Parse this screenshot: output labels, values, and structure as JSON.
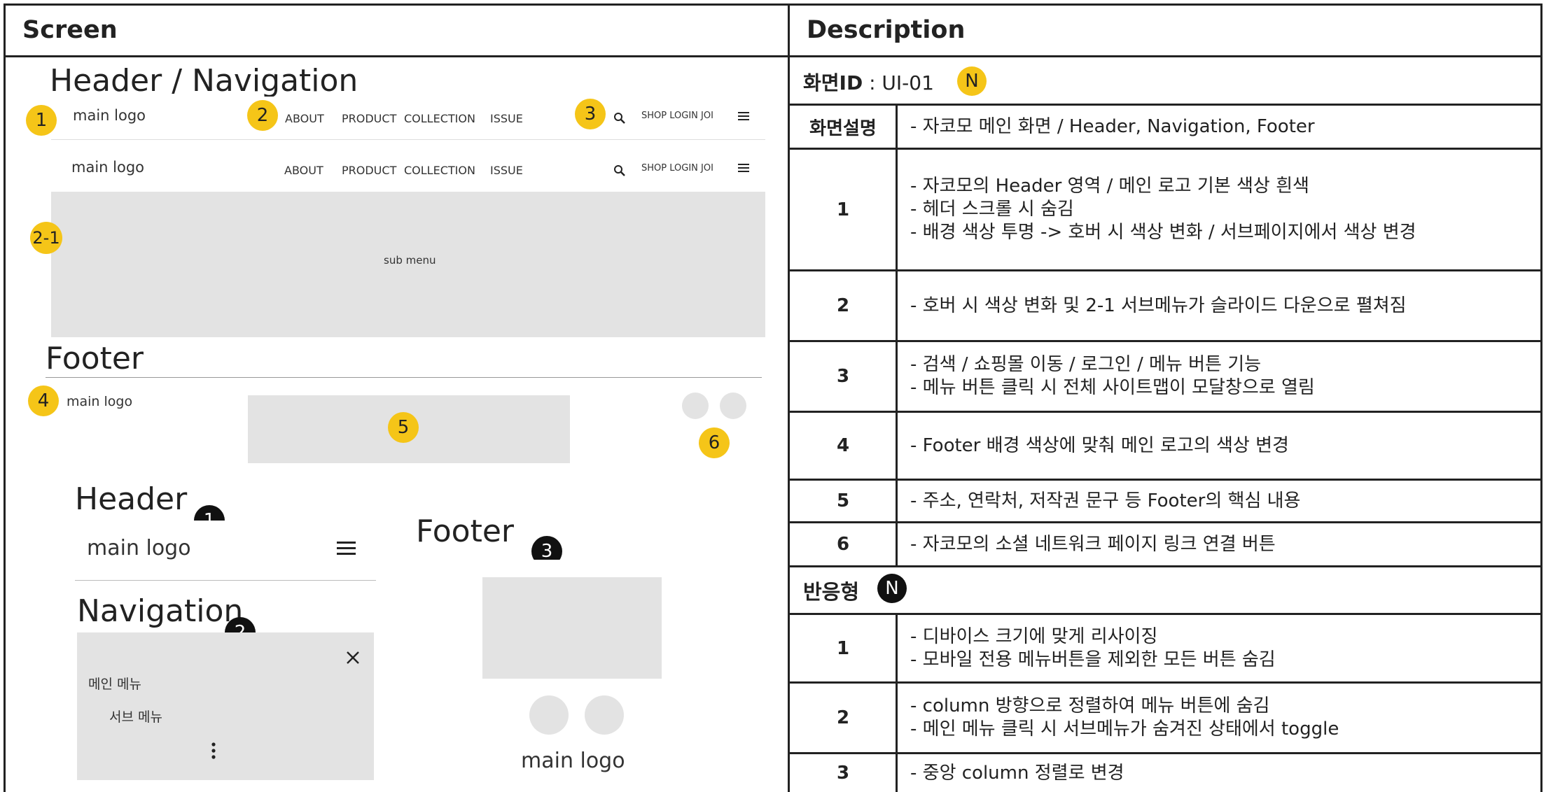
{
  "table_header": {
    "screen": "Screen",
    "description": "Description"
  },
  "left": {
    "section1_title": "Header / Navigation",
    "logo": "main logo",
    "nav": [
      "ABOUT",
      "PRODUCT",
      "COLLECTION",
      "ISSUE"
    ],
    "util_text": "SHOP LOGIN JOI",
    "submenu": "sub menu",
    "badges": {
      "b1": "1",
      "b2": "2",
      "b3": "3",
      "b21": "2-1",
      "b4": "4",
      "b5": "5",
      "b6": "6"
    },
    "footer_title": "Footer",
    "mobile": {
      "header_title": "Header",
      "nav_title": "Navigation",
      "footer_title": "Footer",
      "main_menu": "메인 메뉴",
      "sub_menu": "서브 메뉴",
      "badges": {
        "m1": "1",
        "m2": "2",
        "m3": "3"
      }
    }
  },
  "right": {
    "screen_id_label": "화면ID",
    "screen_id_value": " : UI-01",
    "screen_id_badge": "N",
    "rows": [
      {
        "num": "화면설명",
        "lines": [
          "-  자코모 메인 화면 / Header, Navigation, Footer"
        ]
      },
      {
        "num": "1",
        "lines": [
          "-  자코모의 Header 영역 / 메인 로고 기본 색상 흰색",
          "-  헤더 스크롤 시 숨김",
          "-  배경 색상 투명 -> 호버 시 색상 변화 / 서브페이지에서 색상 변경"
        ]
      },
      {
        "num": "2",
        "lines": [
          "-  호버 시 색상 변화 및 2-1 서브메뉴가 슬라이드 다운으로 펼쳐짐"
        ]
      },
      {
        "num": "3",
        "lines": [
          "-  검색 / 쇼핑몰 이동 / 로그인 / 메뉴 버튼 기능",
          "-  메뉴 버튼 클릭 시 전체 사이트맵이 모달창으로 열림"
        ]
      },
      {
        "num": "4",
        "lines": [
          "-  Footer 배경 색상에 맞춰 메인 로고의 색상 변경"
        ]
      },
      {
        "num": "5",
        "lines": [
          "-  주소, 연락처, 저작권 문구 등 Footer의 핵심 내용"
        ]
      },
      {
        "num": "6",
        "lines": [
          "-  자코모의 소셜 네트워크 페이지 링크 연결 버튼"
        ]
      }
    ],
    "responsive_label": "반응형",
    "responsive_badge": "N",
    "responsive_rows": [
      {
        "num": "1",
        "lines": [
          "- 디바이스 크기에 맞게 리사이징",
          "- 모바일 전용 메뉴버튼을 제외한 모든 버튼 숨김"
        ]
      },
      {
        "num": "2",
        "lines": [
          "- column 방향으로 정렬하여 메뉴 버튼에 숨김",
          "- 메인 메뉴 클릭 시 서브메뉴가 숨겨진 상태에서 toggle"
        ]
      },
      {
        "num": "3",
        "lines": [
          "- 중앙 column 정렬로 변경"
        ]
      }
    ]
  }
}
